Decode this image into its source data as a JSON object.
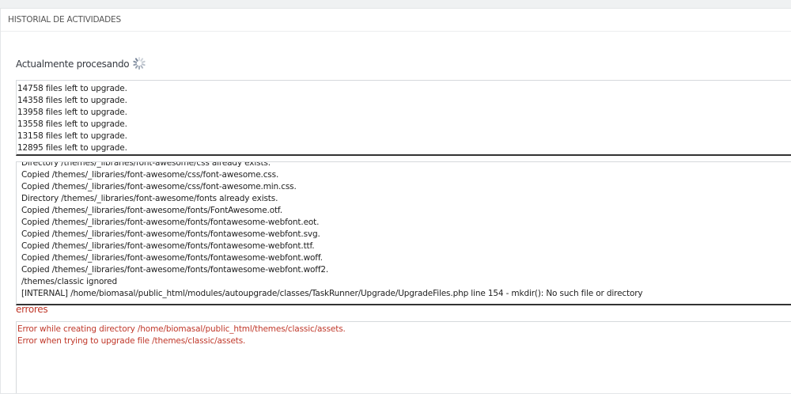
{
  "panel": {
    "title": "HISTORIAL DE ACTIVIDADES"
  },
  "processing": {
    "label": "Actualmente procesando",
    "spinner_icon": "loading-spinner-icon"
  },
  "upgrade_log": [
    "14758 files left to upgrade.",
    "14358 files left to upgrade.",
    "13958 files left to upgrade.",
    "13558 files left to upgrade.",
    "13158 files left to upgrade.",
    "12895 files left to upgrade."
  ],
  "action_log": [
    "Directory /themes/_libraries/font-awesome/css already exists.",
    "Copied /themes/_libraries/font-awesome/css/font-awesome.css.",
    "Copied /themes/_libraries/font-awesome/css/font-awesome.min.css.",
    "Directory /themes/_libraries/font-awesome/fonts already exists.",
    "Copied /themes/_libraries/font-awesome/fonts/FontAwesome.otf.",
    "Copied /themes/_libraries/font-awesome/fonts/fontawesome-webfont.eot.",
    "Copied /themes/_libraries/font-awesome/fonts/fontawesome-webfont.svg.",
    "Copied /themes/_libraries/font-awesome/fonts/fontawesome-webfont.ttf.",
    "Copied /themes/_libraries/font-awesome/fonts/fontawesome-webfont.woff.",
    "Copied /themes/_libraries/font-awesome/fonts/fontawesome-webfont.woff2.",
    "/themes/classic ignored",
    "[INTERNAL] /home/biomasal/public_html/modules/autoupgrade/classes/TaskRunner/Upgrade/UpgradeFiles.php line 154 - mkdir(): No such file or directory"
  ],
  "errors": {
    "label": "errores",
    "color": "#c0392b",
    "lines": [
      "Error while creating directory /home/biomasal/public_html/themes/classic/assets.",
      "Error when trying to upgrade file /themes/classic/assets."
    ]
  }
}
